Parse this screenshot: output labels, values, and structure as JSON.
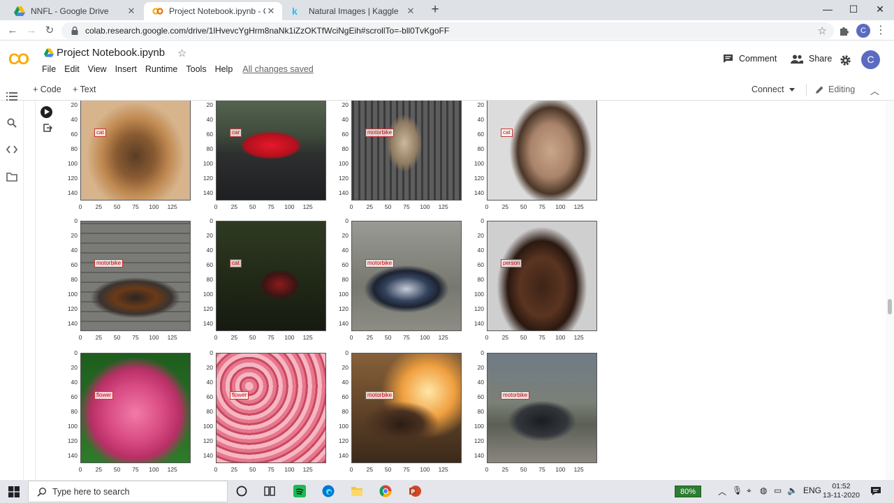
{
  "browser": {
    "tabs": [
      {
        "title": "NNFL - Google Drive",
        "active": false
      },
      {
        "title": "Project Notebook.ipynb - Colab",
        "active": true
      },
      {
        "title": "Natural Images | Kaggle",
        "active": false
      }
    ],
    "url": "colab.research.google.com/drive/1lHvevcYgHrm8naNk1iZzOKTfWciNgEih#scrollTo=-bll0TvKgoFF",
    "profile_initial": "C"
  },
  "colab": {
    "logo": "CO",
    "notebook_title": "Project Notebook.ipynb",
    "menu": [
      "File",
      "Edit",
      "View",
      "Insert",
      "Runtime",
      "Tools",
      "Help"
    ],
    "save_status": "All changes saved",
    "comment_label": "Comment",
    "share_label": "Share",
    "user_initial": "C",
    "add_code_label": "+ Code",
    "add_text_label": "+ Text",
    "connect_label": "Connect",
    "editing_label": "Editing"
  },
  "plot": {
    "yticks_full": [
      "0",
      "20",
      "40",
      "60",
      "80",
      "100",
      "120",
      "140"
    ],
    "xticks": [
      "0",
      "25",
      "50",
      "75",
      "100",
      "125"
    ],
    "rows": [
      [
        {
          "label": "cat",
          "subject": "dog"
        },
        {
          "label": "car",
          "subject": "car"
        },
        {
          "label": "motorbike",
          "subject": "cat"
        },
        {
          "label": "cat",
          "subject": "man"
        }
      ],
      [
        {
          "label": "motorbike",
          "subject": "bike-dark"
        },
        {
          "label": "cat",
          "subject": "bike-red"
        },
        {
          "label": "motorbike",
          "subject": "bike-chrome"
        },
        {
          "label": "person",
          "subject": "boy"
        }
      ],
      [
        {
          "label": "flower",
          "subject": "hydrangea"
        },
        {
          "label": "flower",
          "subject": "phlox"
        },
        {
          "label": "motorbike",
          "subject": "bike-sunset"
        },
        {
          "label": "motorbike",
          "subject": "bike-black"
        }
      ]
    ]
  },
  "taskbar": {
    "search_placeholder": "Type here to search",
    "battery": "80%",
    "language": "ENG",
    "time": "01:52",
    "date": "13-11-2020"
  }
}
